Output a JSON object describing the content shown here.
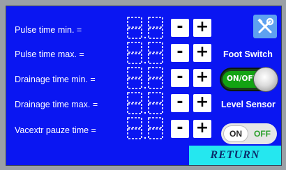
{
  "rows": [
    {
      "label": "Pulse time min. ="
    },
    {
      "label": "Pulse time max. ="
    },
    {
      "label": "Drainage time min. ="
    },
    {
      "label": "Drainage time max. ="
    },
    {
      "label": "Vacextr pauze time ="
    }
  ],
  "buttons": {
    "minus": "-",
    "plus": "+"
  },
  "right_panel": {
    "foot_switch_label": "Foot Switch",
    "foot_switch_toggle_text": "ON/OFF",
    "level_sensor_label": "Level Sensor",
    "level_on": "ON",
    "level_off": "OFF",
    "return_label": "RETURN"
  },
  "colors": {
    "screen_bg": "#0a16f2",
    "return_bg": "#25e7ef",
    "toggle_on": "#13a313",
    "settings_bg": "#5ea1f0"
  },
  "icons": {
    "settings": "wrench-screwdriver-icon",
    "seven_segment": "seven-segment-display-icon"
  }
}
